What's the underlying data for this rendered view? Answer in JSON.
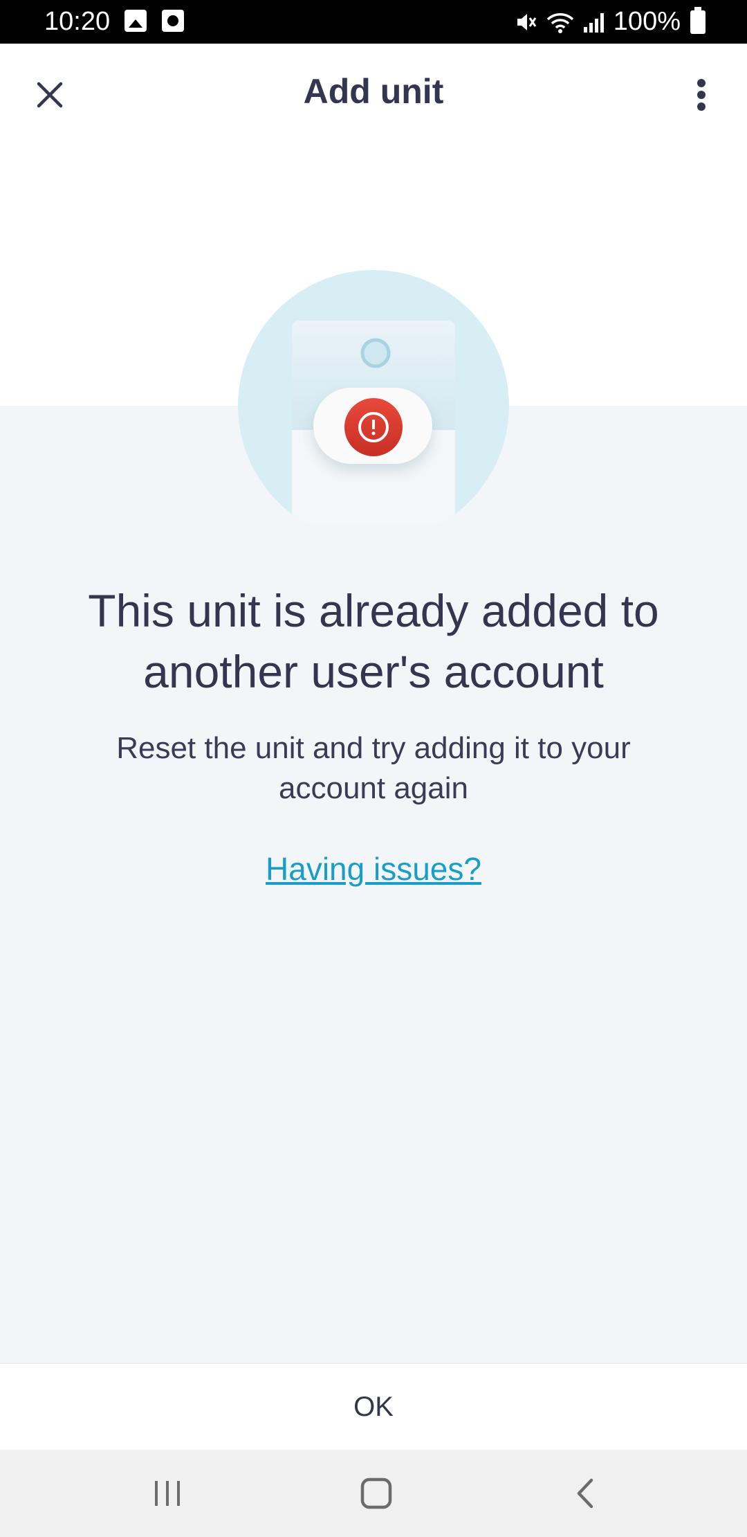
{
  "status_bar": {
    "time": "10:20",
    "battery": "100%"
  },
  "app_bar": {
    "title": "Add unit",
    "close_icon": "close-icon",
    "more_icon": "more-vert-icon"
  },
  "main": {
    "headline": "This unit is already added to another user's account",
    "subtext": "Reset the unit and try adding it to your account again",
    "help_link": "Having issues?",
    "illustration_icon": "error-alert-icon"
  },
  "footer": {
    "ok_label": "OK"
  },
  "colors": {
    "primary_text": "#34364f",
    "link": "#1a9dc8",
    "error": "#d9392e",
    "illustration_circle": "#d7eef5",
    "content_background": "#f3f6f9"
  },
  "nav_bar": {
    "recents_icon": "recents-icon",
    "home_icon": "home-icon",
    "back_icon": "back-icon"
  }
}
